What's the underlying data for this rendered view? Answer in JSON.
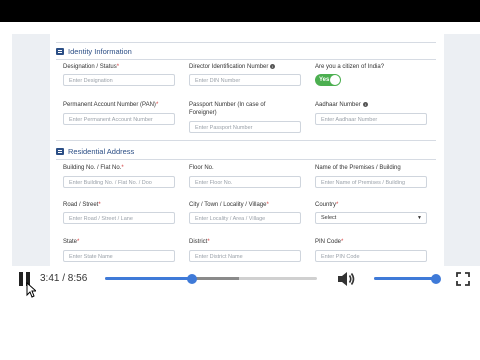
{
  "identity": {
    "title": "Identity Information",
    "designation": {
      "label": "Designation / Status",
      "placeholder": "Enter Designation"
    },
    "din": {
      "label": "Director Identification Number",
      "placeholder": "Enter DIN Number"
    },
    "citizen": {
      "label": "Are you a citizen of India?",
      "value": "Yes"
    },
    "pan": {
      "label": "Permanent Account Number (PAN)",
      "placeholder": "Enter Permanent Account Number"
    },
    "passport": {
      "label_line1": "Passport Number (In case of",
      "label_line2": "Foreigner)",
      "placeholder": "Enter Passport Number"
    },
    "aadhaar": {
      "label": "Aadhaar Number",
      "placeholder": "Enter Aadhaar Number"
    }
  },
  "residential": {
    "title": "Residential Address",
    "building": {
      "label": "Building No. / Flat No.",
      "placeholder": "Enter Building No. / Flat No. / Doo"
    },
    "floor": {
      "label": "Floor No.",
      "placeholder": "Enter Floor No."
    },
    "premises": {
      "label": "Name of the Premises / Building",
      "placeholder": "Enter Name of Premises / Building"
    },
    "road": {
      "label": "Road / Street",
      "placeholder": "Enter Road / Street / Lane"
    },
    "city": {
      "label": "City / Town / Locality / Village",
      "placeholder": "Enter Locality / Area / Village"
    },
    "country": {
      "label": "Country",
      "selected": "Select"
    },
    "state": {
      "label": "State",
      "placeholder": "Enter State Name"
    },
    "district": {
      "label": "District",
      "placeholder": "Enter District Name"
    },
    "pin": {
      "label": "PIN Code",
      "placeholder": "Enter PIN Code"
    }
  },
  "player": {
    "time": "3:41 / 8:56",
    "progress": 0.41,
    "buffered": 0.63,
    "volume": 1.0,
    "accent": "#3f7ad8",
    "icons": [
      "pause-icon",
      "volume-icon",
      "fullscreen-icon"
    ]
  }
}
